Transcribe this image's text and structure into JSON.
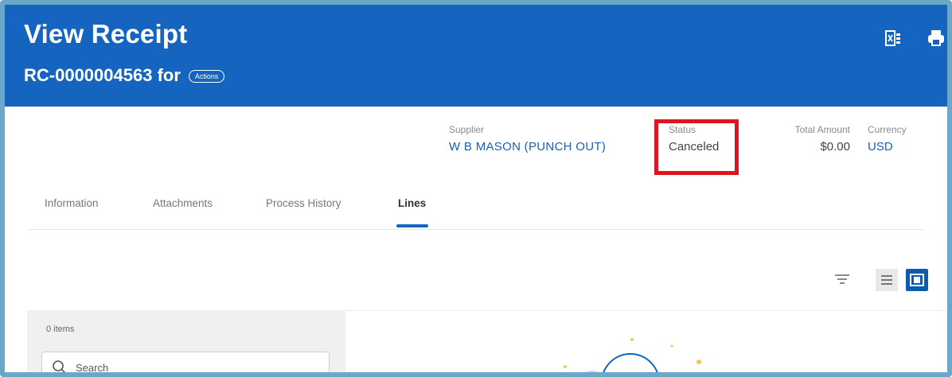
{
  "header": {
    "title": "View Receipt",
    "subtitle": "RC-0000004563 for",
    "actions_label": "Actions",
    "icons": [
      "excel-export-icon",
      "print-icon"
    ]
  },
  "meta": {
    "supplier": {
      "label": "Supplier",
      "value": "W B MASON (PUNCH OUT)"
    },
    "status": {
      "label": "Status",
      "value": "Canceled"
    },
    "total": {
      "label": "Total Amount",
      "value": "$0.00"
    },
    "currency": {
      "label": "Currency",
      "value": "USD"
    }
  },
  "tabs": [
    {
      "label": "Information"
    },
    {
      "label": "Attachments"
    },
    {
      "label": "Process History"
    },
    {
      "label": "Lines",
      "active": true
    }
  ],
  "lines": {
    "items_count": "0 items",
    "search_placeholder": "Search",
    "toolbar_icons": [
      "filter-icon",
      "list-view-icon",
      "detail-view-icon"
    ]
  },
  "colors": {
    "header_bg": "#1565c0",
    "link_blue": "#1a5fb4",
    "highlight_red": "#e0141e",
    "frame_border": "#6aa7c8"
  }
}
